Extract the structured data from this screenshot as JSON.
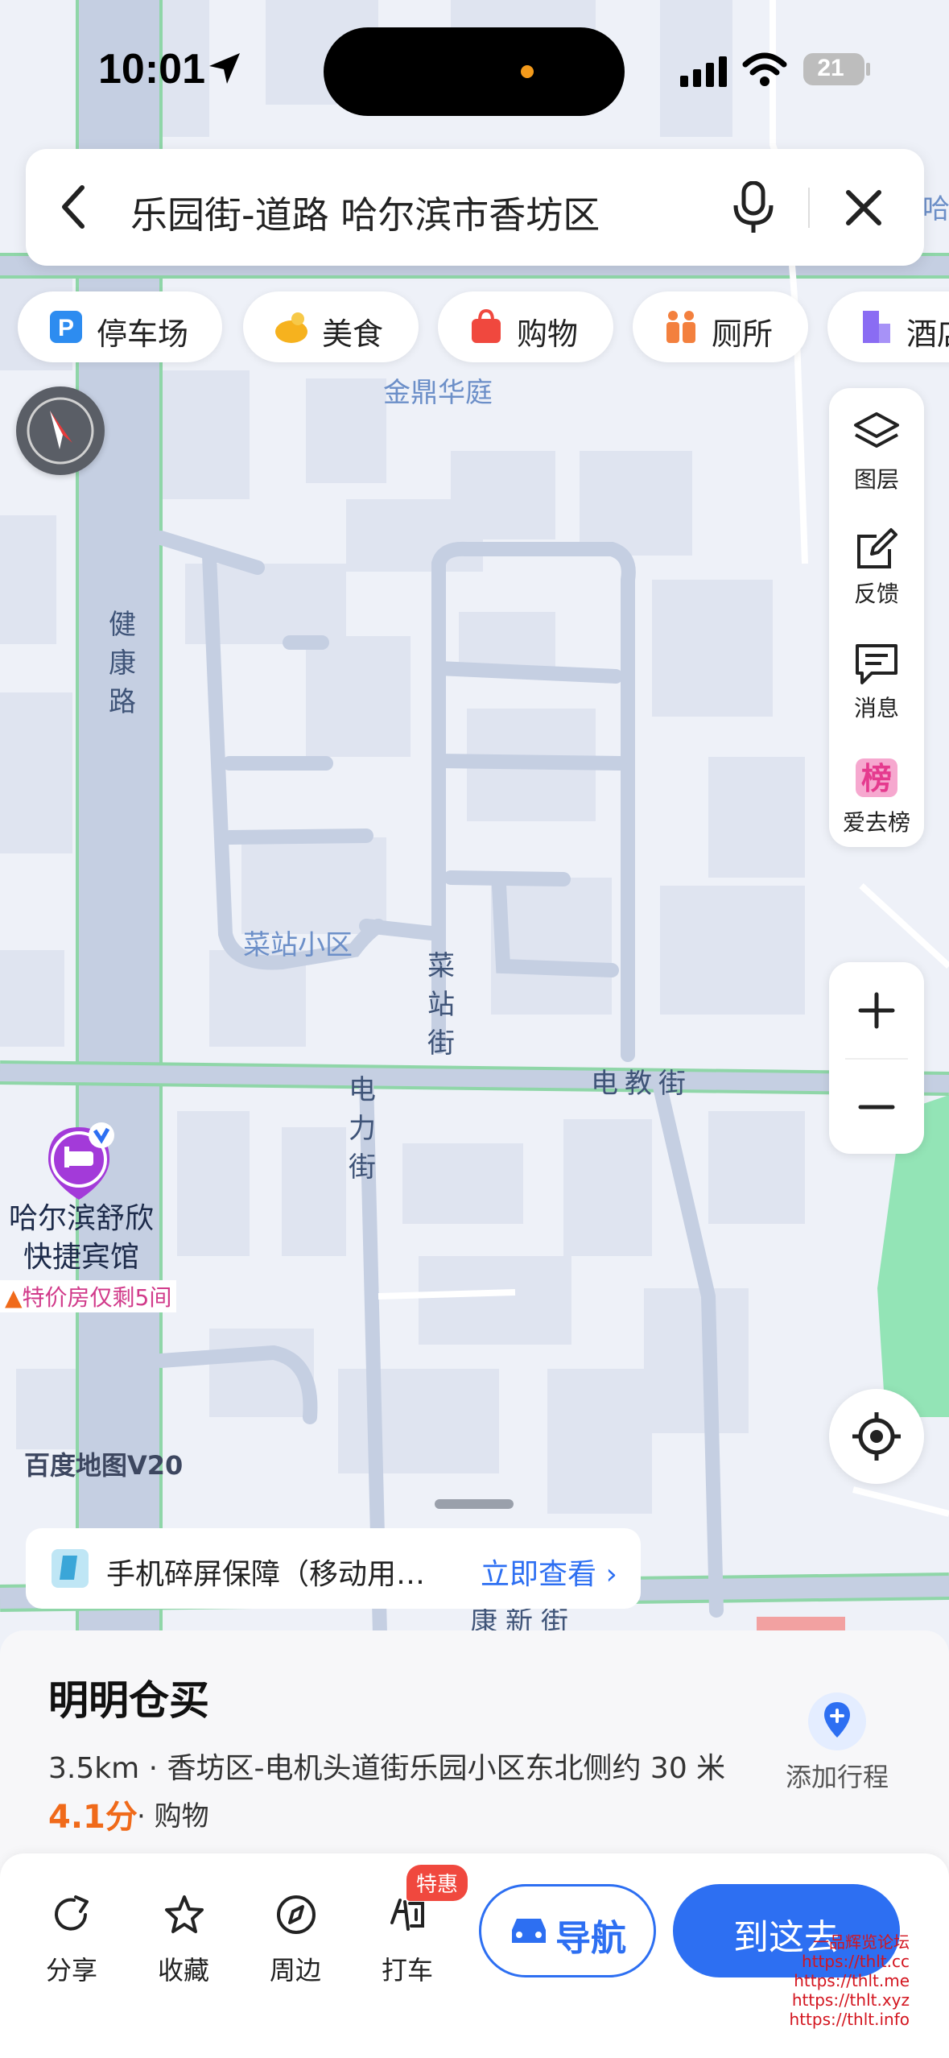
{
  "status_bar": {
    "time": "10:01",
    "battery": "21"
  },
  "search": {
    "query": "乐园街-道路 哈尔滨市香坊区"
  },
  "chips": [
    {
      "label": "停车场",
      "icon": "parking-icon"
    },
    {
      "label": "美食",
      "icon": "food-icon"
    },
    {
      "label": "购物",
      "icon": "shopping-bag-icon"
    },
    {
      "label": "厕所",
      "icon": "restroom-icon"
    },
    {
      "label": "酒店",
      "icon": "hotel-icon"
    }
  ],
  "right_panel": [
    {
      "label": "图层",
      "icon": "layers-icon"
    },
    {
      "label": "反馈",
      "icon": "feedback-icon"
    },
    {
      "label": "消息",
      "icon": "message-icon"
    },
    {
      "label": "爱去榜",
      "icon": "ranking-icon"
    }
  ],
  "map_labels": {
    "jinding": "金鼎华庭",
    "caizhan_community": "菜站小区",
    "jiankang_road": "健康路",
    "caizhan_street": "菜站街",
    "dianli_street": "电力街",
    "dianjiao_street": "电教街",
    "kangxin_street": "康新街",
    "top_right": "哈"
  },
  "poi": {
    "name": "哈尔滨舒欣快捷宾馆",
    "tag": "特价房仅剩5间"
  },
  "watermark": "百度地图V20",
  "ad": {
    "text": "手机碎屏保障（移动用…",
    "link": "立即查看 ›"
  },
  "place": {
    "title": "明明仓买",
    "address": "3.5km · 香坊区-电机头道街乐园小区东北侧约 30 米",
    "rating": "4.1分",
    "category": "· 购物",
    "add_trip": "添加行程"
  },
  "actions": [
    {
      "label": "分享",
      "icon": "share-icon"
    },
    {
      "label": "收藏",
      "icon": "star-icon"
    },
    {
      "label": "周边",
      "icon": "compass-icon"
    },
    {
      "label": "打车",
      "icon": "taxi-icon"
    }
  ],
  "taxi_badge": "特惠",
  "nav_button": "导航",
  "go_button": "到这去",
  "site_mark": [
    "一品辉览论坛",
    "https://thlt.cc",
    "https://thlt.me",
    "https://thlt.xyz",
    "https://thlt.info"
  ],
  "colors": {
    "accent": "#2d6ff2",
    "rating": "#f06a1a",
    "road_outline": "#8fd6a8",
    "road_fill": "#c5cfe2"
  }
}
